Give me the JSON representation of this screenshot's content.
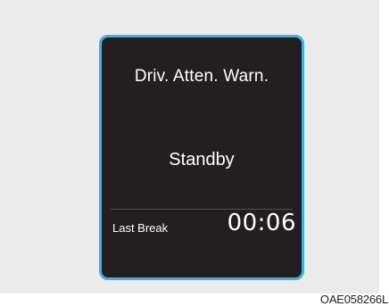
{
  "display": {
    "title": "Driv. Atten. Warn.",
    "status": "Standby",
    "last_break_label": "Last Break",
    "last_break_time": "00:06"
  },
  "figure_code": "OAE058266L",
  "colors": {
    "background": "#ebebeb",
    "screen": "#231f20",
    "border": "#3fb1e1",
    "text": "#ffffff"
  }
}
